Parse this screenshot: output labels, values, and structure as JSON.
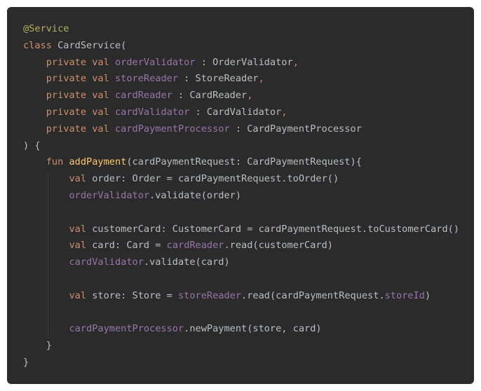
{
  "colors": {
    "background": "#2b2b2b",
    "default_text": "#bcbec4",
    "keyword": "#cf8e6d",
    "annotation": "#b3ae60",
    "property": "#9876aa",
    "function": "#ffc66d"
  },
  "code": {
    "lines": [
      {
        "indent": 0,
        "tokens": [
          [
            "annotation",
            "@Service"
          ]
        ]
      },
      {
        "indent": 0,
        "tokens": [
          [
            "keyword",
            "class "
          ],
          [
            "text",
            "CardService("
          ]
        ]
      },
      {
        "indent": 1,
        "tokens": [
          [
            "keyword",
            "private val "
          ],
          [
            "property",
            "orderValidator"
          ],
          [
            "text",
            " : OrderValidator"
          ],
          [
            "punct",
            ","
          ]
        ]
      },
      {
        "indent": 1,
        "tokens": [
          [
            "keyword",
            "private val "
          ],
          [
            "property",
            "storeReader"
          ],
          [
            "text",
            " : StoreReader"
          ],
          [
            "punct",
            ","
          ]
        ]
      },
      {
        "indent": 1,
        "tokens": [
          [
            "keyword",
            "private val "
          ],
          [
            "property",
            "cardReader"
          ],
          [
            "text",
            " : CardReader"
          ],
          [
            "punct",
            ","
          ]
        ]
      },
      {
        "indent": 1,
        "tokens": [
          [
            "keyword",
            "private val "
          ],
          [
            "property",
            "cardValidator"
          ],
          [
            "text",
            " : CardValidator"
          ],
          [
            "punct",
            ","
          ]
        ]
      },
      {
        "indent": 1,
        "tokens": [
          [
            "keyword",
            "private val "
          ],
          [
            "property",
            "cardPaymentProcessor"
          ],
          [
            "text",
            " : CardPaymentProcessor"
          ]
        ]
      },
      {
        "indent": 0,
        "tokens": [
          [
            "text",
            ") {"
          ]
        ]
      },
      {
        "indent": 1,
        "tokens": [
          [
            "keyword",
            "fun "
          ],
          [
            "fn",
            "addPayment"
          ],
          [
            "text",
            "(cardPaymentRequest: CardPaymentRequest){"
          ]
        ]
      },
      {
        "indent": 2,
        "tokens": [
          [
            "keyword",
            "val "
          ],
          [
            "text",
            "order: Order = cardPaymentRequest.toOrder()"
          ]
        ]
      },
      {
        "indent": 2,
        "tokens": [
          [
            "property",
            "orderValidator"
          ],
          [
            "text",
            ".validate(order)"
          ]
        ]
      },
      {
        "indent": 2,
        "tokens": []
      },
      {
        "indent": 2,
        "tokens": [
          [
            "keyword",
            "val "
          ],
          [
            "text",
            "customerCard: CustomerCard = cardPaymentRequest.toCustomerCard()"
          ]
        ]
      },
      {
        "indent": 2,
        "tokens": [
          [
            "keyword",
            "val "
          ],
          [
            "text",
            "card: Card = "
          ],
          [
            "property",
            "cardReader"
          ],
          [
            "text",
            ".read(customerCard)"
          ]
        ]
      },
      {
        "indent": 2,
        "tokens": [
          [
            "property",
            "cardValidator"
          ],
          [
            "text",
            ".validate(card)"
          ]
        ]
      },
      {
        "indent": 2,
        "tokens": []
      },
      {
        "indent": 2,
        "tokens": [
          [
            "keyword",
            "val "
          ],
          [
            "text",
            "store: Store = "
          ],
          [
            "property",
            "storeReader"
          ],
          [
            "text",
            ".read(cardPaymentRequest."
          ],
          [
            "property",
            "storeId"
          ],
          [
            "text",
            ")"
          ]
        ]
      },
      {
        "indent": 2,
        "tokens": []
      },
      {
        "indent": 2,
        "tokens": [
          [
            "property",
            "cardPaymentProcessor"
          ],
          [
            "text",
            ".newPayment(store, card)"
          ]
        ]
      },
      {
        "indent": 1,
        "tokens": [
          [
            "text",
            "}"
          ]
        ]
      },
      {
        "indent": 0,
        "tokens": [
          [
            "text",
            "}"
          ]
        ]
      }
    ]
  }
}
